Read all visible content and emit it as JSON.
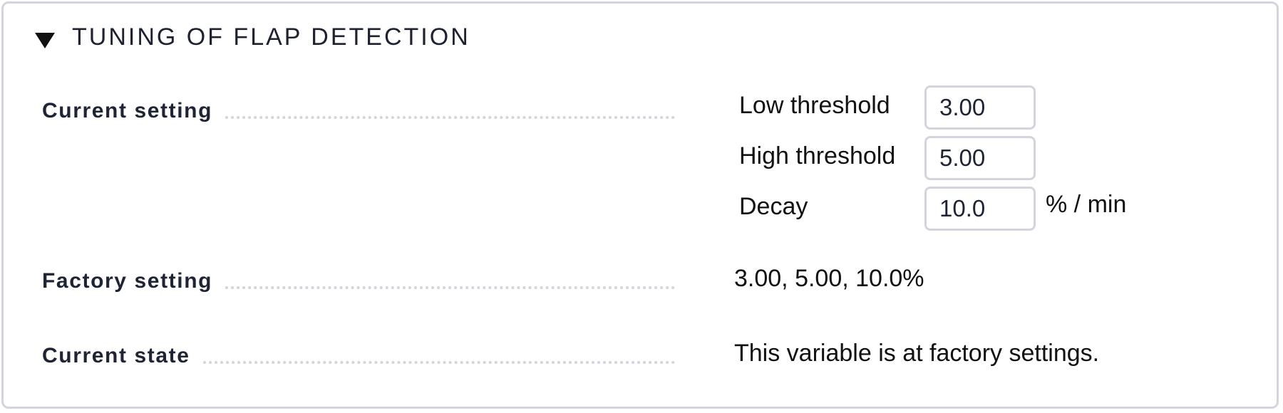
{
  "section": {
    "title": "TUNING OF FLAP DETECTION",
    "toggle_icon": "triangle-down-icon"
  },
  "current_setting": {
    "label": "Current setting",
    "fields": [
      {
        "label": "Low threshold",
        "value": "3.00"
      },
      {
        "label": "High threshold",
        "value": "5.00"
      },
      {
        "label": "Decay",
        "value": "10.0",
        "unit": "% / min"
      }
    ]
  },
  "factory_setting": {
    "label": "Factory setting",
    "value": "3.00, 5.00, 10.0%"
  },
  "current_state": {
    "label": "Current state",
    "value": "This variable is at factory settings."
  },
  "colors": {
    "border": "#d3d4dd",
    "label_text": "#1e2434",
    "text": "#111111"
  }
}
